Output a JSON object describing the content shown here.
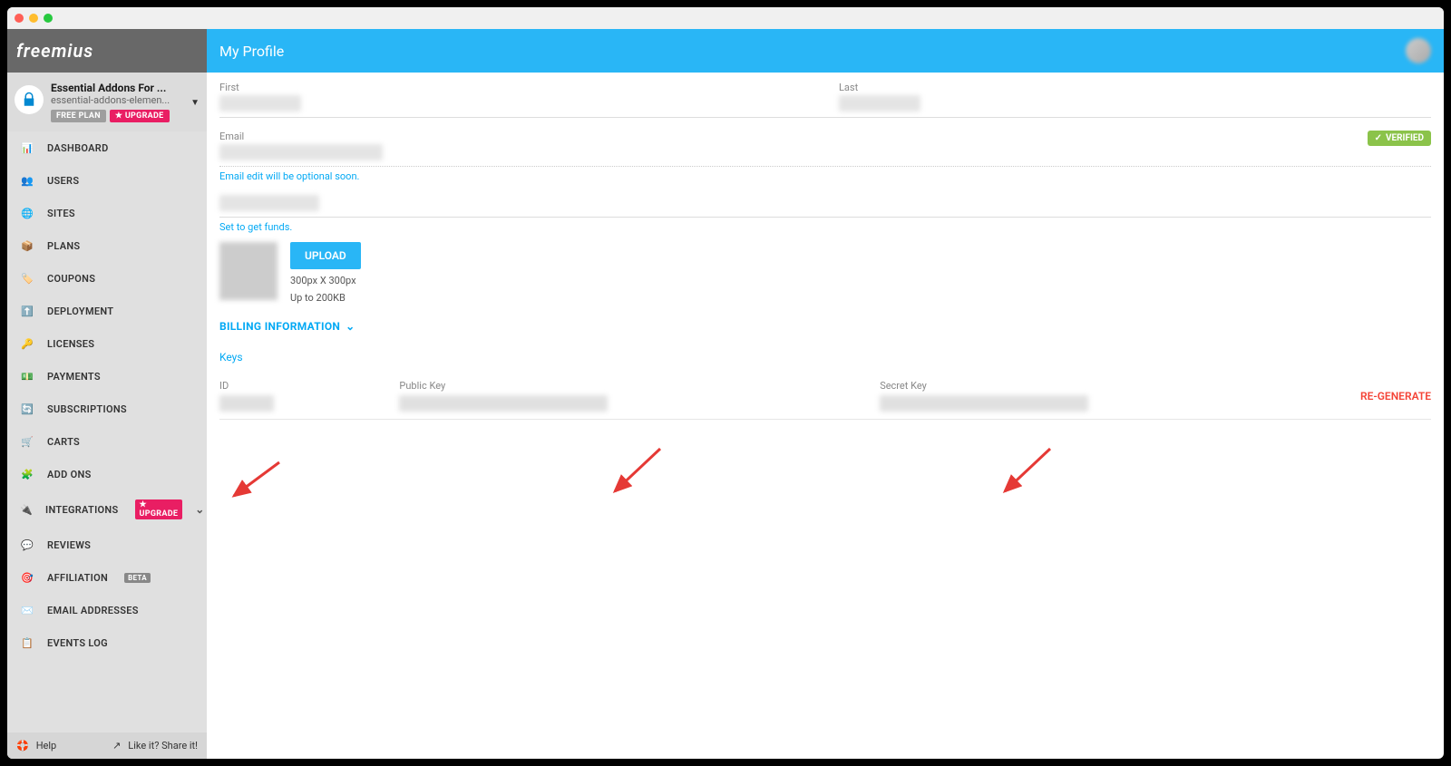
{
  "brand": "freemius",
  "header": {
    "title": "My Profile"
  },
  "product": {
    "title": "Essential Addons For ...",
    "slug": "essential-addons-elemen...",
    "plan_badge": "FREE PLAN",
    "upgrade_label": "★ UPGRADE"
  },
  "nav": {
    "dashboard": "DASHBOARD",
    "users": "USERS",
    "sites": "SITES",
    "plans": "PLANS",
    "coupons": "COUPONS",
    "deployment": "DEPLOYMENT",
    "licenses": "LICENSES",
    "payments": "PAYMENTS",
    "subscriptions": "SUBSCRIPTIONS",
    "carts": "CARTS",
    "addons": "ADD ONS",
    "integrations": "INTEGRATIONS",
    "integrations_badge": "★ UPGRADE",
    "reviews": "REVIEWS",
    "affiliation": "AFFILIATION",
    "affiliation_badge": "BETA",
    "email_addresses": "EMAIL ADDRESSES",
    "events_log": "EVENTS LOG"
  },
  "footer": {
    "help": "Help",
    "share": "Like it? Share it!"
  },
  "form": {
    "first_label": "First",
    "last_label": "Last",
    "email_label": "Email",
    "email_note": "Email edit will be optional soon.",
    "verified_label": "VERIFIED",
    "funds_note": "Set to get funds.",
    "upload_label": "UPLOAD",
    "upload_size": "300px X 300px",
    "upload_limit": "Up to 200KB",
    "billing_section": "BILLING INFORMATION"
  },
  "keys": {
    "section_title": "Keys",
    "id_label": "ID",
    "pk_label": "Public Key",
    "sk_label": "Secret Key",
    "regenerate": "RE-GENERATE"
  }
}
